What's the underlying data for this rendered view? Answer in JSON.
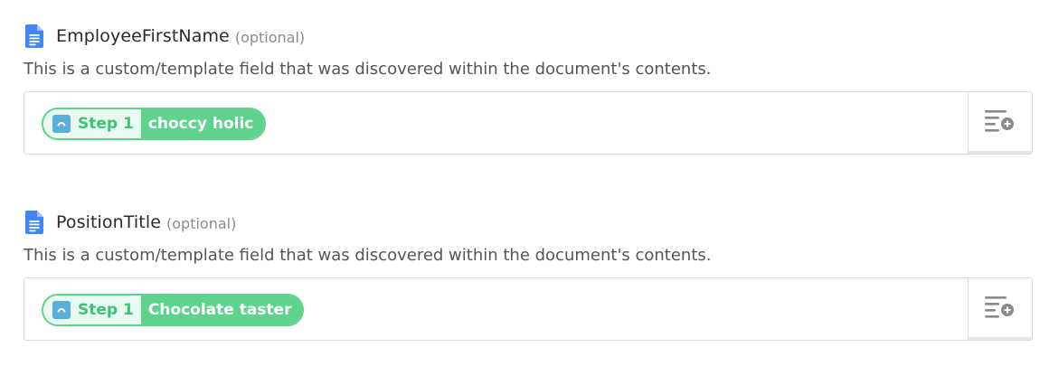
{
  "fields": [
    {
      "name": "EmployeeFirstName",
      "optional_label": "(optional)",
      "help_text": "This is a custom/template field that was discovered within the document's contents.",
      "pill": {
        "step_label": "Step 1",
        "value": "choccy holic"
      }
    },
    {
      "name": "PositionTitle",
      "optional_label": "(optional)",
      "help_text": "This is a custom/template field that was discovered within the document's contents.",
      "pill": {
        "step_label": "Step 1",
        "value": "Chocolate taster"
      }
    }
  ],
  "icons": {
    "field_icon": "google-docs-icon",
    "app_icon": "app-step-icon",
    "add_button_icon": "insert-data-icon"
  },
  "colors": {
    "doc_blue": "#4285f4",
    "pill_green": "#5fd38d",
    "step_text_green": "#3fc27a",
    "app_icon_blue": "#5aaedc"
  }
}
